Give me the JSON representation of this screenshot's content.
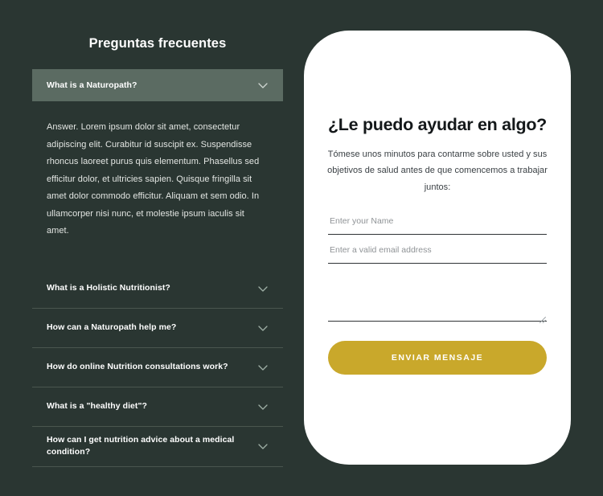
{
  "theme": {
    "page_background": "#2a3632",
    "card_background": "#ffffff",
    "accent_button": "#c9a82b",
    "active_item_background": "#5b6b62",
    "divider": "#4a564f",
    "heading_text": "#ffffff",
    "body_text": "#e3e6e3"
  },
  "faq": {
    "title": "Preguntas frecuentes",
    "chevron_icon": "chevron-down-icon",
    "items": [
      {
        "question": "What is a Naturopath?",
        "expanded": true,
        "answer": "Answer. Lorem ipsum dolor sit amet, consectetur adipiscing elit. Curabitur id suscipit ex. Suspendisse rhoncus laoreet purus quis elementum. Phasellus sed efficitur dolor, et ultricies sapien. Quisque fringilla sit amet dolor commodo efficitur. Aliquam et sem odio. In ullamcorper nisi nunc, et molestie ipsum iaculis sit amet."
      },
      {
        "question": "What is a Holistic Nutritionist?",
        "expanded": false,
        "answer": ""
      },
      {
        "question": "How can a Naturopath help me?",
        "expanded": false,
        "answer": ""
      },
      {
        "question": "How do online Nutrition consultations work?",
        "expanded": false,
        "answer": ""
      },
      {
        "question": "What is a \"healthy diet\"?",
        "expanded": false,
        "answer": ""
      },
      {
        "question": "How can I get nutrition advice about a medical condition?",
        "expanded": false,
        "answer": ""
      }
    ]
  },
  "contact_form": {
    "title": "¿Le puedo ayudar en algo?",
    "subtitle": "Tómese unos minutos para contarme sobre usted y sus objetivos de salud antes de que comencemos a trabajar juntos:",
    "name_field": {
      "placeholder": "Enter your Name",
      "value": ""
    },
    "email_field": {
      "placeholder": "Enter a valid email address",
      "value": ""
    },
    "message_field": {
      "placeholder": "",
      "value": ""
    },
    "submit_label": "ENVIAR MENSAJE",
    "resize_grip_icon": "resize-handle-icon"
  }
}
